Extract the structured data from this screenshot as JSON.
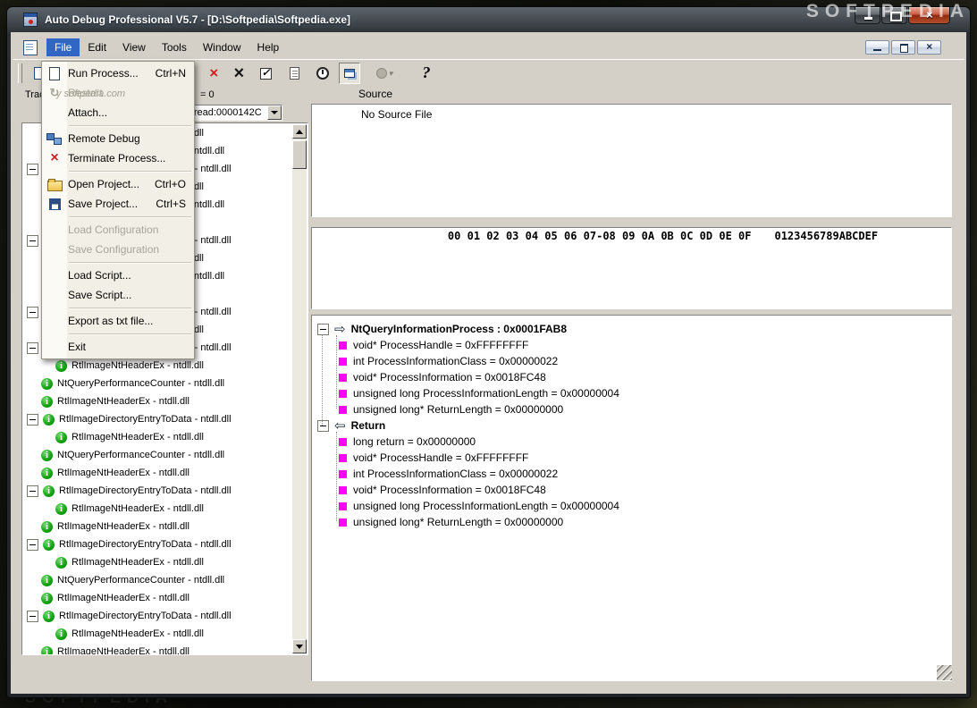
{
  "desktop": {
    "watermark_top_right": "SOFTPEDIA",
    "watermark_bottom_left": "SOFTPEDIA"
  },
  "window": {
    "title": "Auto Debug Professional V5.7 - [D:\\Softpedia\\Softpedia.exe]",
    "caption_buttons": [
      "minimize",
      "maximize",
      "close"
    ]
  },
  "menubar": {
    "items": [
      "File",
      "Edit",
      "View",
      "Tools",
      "Window",
      "Help"
    ],
    "active": "File"
  },
  "mdi_buttons": [
    "minimize",
    "restore",
    "close"
  ],
  "toolbar": {
    "buttons": [
      {
        "name": "new-process",
        "icon": "new-page-icon"
      },
      {
        "name": "remove",
        "icon": "red-x-icon"
      },
      {
        "name": "remove-all",
        "icon": "black-x-icon"
      },
      {
        "name": "verify",
        "icon": "checkbox-icon"
      },
      {
        "name": "edit-script",
        "icon": "edit-page-icon"
      },
      {
        "name": "timer",
        "icon": "timer-icon"
      },
      {
        "name": "windows",
        "icon": "windows-icon",
        "state": "pressed"
      },
      {
        "name": "options",
        "icon": "gray-disc-icon",
        "state": "disabled",
        "caret": true
      },
      {
        "name": "help",
        "icon": "help-icon"
      }
    ]
  },
  "file_menu": {
    "watermark": "y softpedia.com",
    "items": [
      {
        "label": "Run Process...",
        "shortcut": "Ctrl+N",
        "icon": "run-process-icon",
        "enabled": true
      },
      {
        "label": "Restart",
        "icon": "restart-icon",
        "enabled": false
      },
      {
        "label": "Attach...",
        "enabled": true
      },
      {
        "sep": true
      },
      {
        "label": "Remote Debug",
        "icon": "remote-debug-icon",
        "enabled": true
      },
      {
        "label": "Terminate Process...",
        "icon": "terminate-process-icon",
        "enabled": true
      },
      {
        "sep": true
      },
      {
        "label": "Open Project...",
        "shortcut": "Ctrl+O",
        "icon": "open-project-icon",
        "enabled": true
      },
      {
        "label": "Save Project...",
        "shortcut": "Ctrl+S",
        "icon": "save-project-icon",
        "enabled": true
      },
      {
        "sep": true
      },
      {
        "label": "Load Configuration",
        "enabled": false
      },
      {
        "label": "Save Configuration",
        "enabled": false
      },
      {
        "sep": true
      },
      {
        "label": "Load Script...",
        "enabled": true
      },
      {
        "label": "Save Script...",
        "enabled": true
      },
      {
        "sep": true
      },
      {
        "label": "Export as txt file...",
        "enabled": true
      },
      {
        "sep": true
      },
      {
        "label": "Exit",
        "enabled": true
      }
    ]
  },
  "left_panel": {
    "header_label": "Trace",
    "count_text": "= 0",
    "thread_combo": "Thread:0000142C",
    "tree": [
      {
        "text": "RtlImageNtHeaderEx - ntdll.dll",
        "indent": 1,
        "expand": false
      },
      {
        "text": "NtQueryPerformanceCounter - ntdll.dll",
        "indent": 0,
        "expand": false
      },
      {
        "text": "RtlImageDirectoryEntryToData - ntdll.dll",
        "indent": 0,
        "expand": true
      },
      {
        "text": "RtlImageNtHeaderEx - ntdll.dll",
        "indent": 1,
        "expand": false
      },
      {
        "text": "NtQueryPerformanceCounter - ntdll.dll",
        "indent": 0,
        "expand": false
      },
      {
        "text": "RtlImageNtHeaderEx - ntdll.dll",
        "indent": 0,
        "expand": false
      },
      {
        "text": "RtlImageDirectoryEntryToData - ntdll.dll",
        "indent": 0,
        "expand": true
      },
      {
        "text": "RtlImageNtHeaderEx - ntdll.dll",
        "indent": 1,
        "expand": false
      },
      {
        "text": "NtQueryPerformanceCounter - ntdll.dll",
        "indent": 0,
        "expand": false
      },
      {
        "text": "RtlImageNtHeaderEx - ntdll.dll",
        "indent": 0,
        "expand": false
      },
      {
        "text": "RtlImageDirectoryEntryToData - ntdll.dll",
        "indent": 0,
        "expand": true
      },
      {
        "text": "RtlImageNtHeaderEx - ntdll.dll",
        "indent": 1,
        "expand": false
      },
      {
        "text": "RtlImageDirectoryEntryToData - ntdll.dll",
        "indent": 0,
        "expand": true
      },
      {
        "text": "RtlImageNtHeaderEx - ntdll.dll",
        "indent": 1,
        "expand": false
      },
      {
        "text": "NtQueryPerformanceCounter - ntdll.dll",
        "indent": 0,
        "expand": false
      },
      {
        "text": "RtlImageNtHeaderEx - ntdll.dll",
        "indent": 0,
        "expand": false
      },
      {
        "text": "RtlImageDirectoryEntryToData - ntdll.dll",
        "indent": 0,
        "expand": true
      },
      {
        "text": "RtlImageNtHeaderEx - ntdll.dll",
        "indent": 1,
        "expand": false
      },
      {
        "text": "NtQueryPerformanceCounter - ntdll.dll",
        "indent": 0,
        "expand": false
      },
      {
        "text": "RtlImageNtHeaderEx - ntdll.dll",
        "indent": 0,
        "expand": false
      },
      {
        "text": "RtlImageDirectoryEntryToData - ntdll.dll",
        "indent": 0,
        "expand": true
      },
      {
        "text": "RtlImageNtHeaderEx - ntdll.dll",
        "indent": 1,
        "expand": false
      },
      {
        "text": "RtlImageNtHeaderEx - ntdll.dll",
        "indent": 0,
        "expand": false
      },
      {
        "text": "RtlImageDirectoryEntryToData - ntdll.dll",
        "indent": 0,
        "expand": true
      },
      {
        "text": "RtlImageNtHeaderEx - ntdll.dll",
        "indent": 1,
        "expand": false
      },
      {
        "text": "NtQueryPerformanceCounter - ntdll.dll",
        "indent": 0,
        "expand": false
      },
      {
        "text": "RtlImageNtHeaderEx - ntdll.dll",
        "indent": 0,
        "expand": false
      },
      {
        "text": "RtlImageDirectoryEntryToData - ntdll.dll",
        "indent": 0,
        "expand": true
      },
      {
        "text": "RtlImageNtHeaderEx - ntdll.dll",
        "indent": 1,
        "expand": false
      },
      {
        "text": "RtlImageNtHeaderEx - ntdll.dll",
        "indent": 0,
        "expand": false
      }
    ]
  },
  "source_panel": {
    "header": "Source",
    "empty_text": "No Source File"
  },
  "hex_panel": {
    "columns": "00 01 02 03 04 05 06 07-08 09 0A 0B 0C 0D 0E 0F",
    "ascii": "0123456789ABCDEF"
  },
  "call_panel": {
    "groups": [
      {
        "direction": "right",
        "title": "NtQueryInformationProcess : 0x0001FAB8",
        "params": [
          "void* ProcessHandle = 0xFFFFFFFF",
          "int ProcessInformationClass = 0x00000022",
          "void* ProcessInformation = 0x0018FC48",
          "unsigned long ProcessInformationLength = 0x00000004",
          "unsigned long* ReturnLength = 0x00000000"
        ]
      },
      {
        "direction": "left",
        "title": "Return",
        "params": [
          "long return = 0x00000000",
          "void* ProcessHandle = 0xFFFFFFFF",
          "int ProcessInformationClass = 0x00000022",
          "void* ProcessInformation = 0x0018FC48",
          "unsigned long ProcessInformationLength = 0x00000004",
          "unsigned long* ReturnLength = 0x00000000"
        ]
      }
    ]
  },
  "colors": {
    "menu_highlight": "#3166c4",
    "param_bullet": "#ff00ff",
    "info_icon": "#12a012",
    "close_button": "#b8493a"
  }
}
